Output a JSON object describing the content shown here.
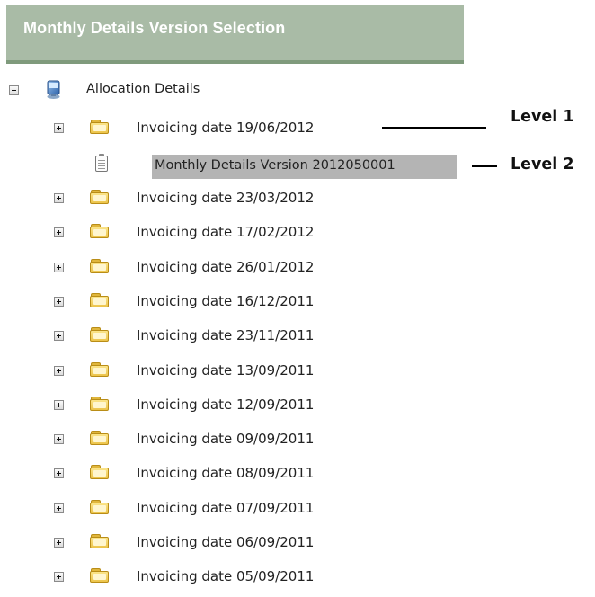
{
  "header": {
    "title": "Monthly Details Version Selection"
  },
  "tree": {
    "root": {
      "label": "Allocation Details",
      "expanded": true,
      "icon": "computer-icon"
    },
    "first_node": {
      "label": "Invoicing date 19/06/2012",
      "expanded": false,
      "icon": "folder-icon"
    },
    "selected_child": {
      "label": "Monthly Details Version 2012050001",
      "icon": "document-icon"
    },
    "nodes": [
      "Invoicing date 23/03/2012",
      "Invoicing date 17/02/2012",
      "Invoicing date 26/01/2012",
      "Invoicing date 16/12/2011",
      "Invoicing date 23/11/2011",
      "Invoicing date 13/09/2011",
      "Invoicing date 12/09/2011",
      "Invoicing date 09/09/2011",
      "Invoicing date 08/09/2011",
      "Invoicing date 07/09/2011",
      "Invoicing date 06/09/2011",
      "Invoicing date 05/09/2011"
    ]
  },
  "annotations": {
    "level1": "Level 1",
    "level2": "Level 2"
  },
  "colors": {
    "header_bg": "#a9bba6",
    "header_border": "#7f9a7c",
    "selection_bg": "#b4b4b4",
    "folder": "#ecc34a"
  }
}
